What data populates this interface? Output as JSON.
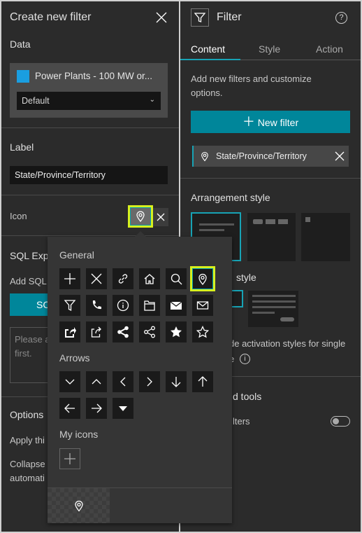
{
  "left": {
    "title": "Create new filter",
    "data_heading": "Data",
    "layer_name": "Power Plants - 100 MW or...",
    "view_select": "Default",
    "label_heading": "Label",
    "label_value": "State/Province/Territory",
    "icon_label": "Icon",
    "sql_heading": "SQL Exp",
    "sql_text": "Add SQL",
    "sql_button": "SC",
    "sql_placeholder_1": "Please a",
    "sql_placeholder_2": "first.",
    "options_heading": "Options",
    "apply_text": "Apply thi",
    "collapse_text_1": "Collapse",
    "collapse_text_2": "automati"
  },
  "right": {
    "title": "Filter",
    "tabs": [
      {
        "label": "Content",
        "active": true
      },
      {
        "label": "Style",
        "active": false
      },
      {
        "label": "Action",
        "active": false
      }
    ],
    "description": "Add new filters and customize options.",
    "new_filter_button": "New filter",
    "filter_item": "State/Province/Territory",
    "arrangement_heading": "Arrangement style",
    "activation_heading_fragment": "style",
    "activation_text_1": "de activation styles for single",
    "activation_text_2": "e",
    "tools_heading_fragment": "d tools",
    "filters_toggle_fragment": "lters",
    "toggle_on": false
  },
  "icon_picker": {
    "general_heading": "General",
    "general_icons": [
      "plus",
      "close",
      "link",
      "home",
      "search",
      "map-pin",
      "filter",
      "phone",
      "info",
      "folder",
      "envelope-filled",
      "envelope",
      "share-filled",
      "share",
      "share-nodes-filled",
      "share-nodes",
      "star-filled",
      "star"
    ],
    "selected_icon": "map-pin",
    "arrows_heading": "Arrows",
    "arrow_icons": [
      "chevron-down",
      "chevron-up",
      "chevron-left",
      "chevron-right",
      "arrow-down",
      "arrow-up",
      "arrow-left",
      "arrow-right",
      "caret-down"
    ],
    "my_icons_heading": "My icons",
    "preview_icon": "map-pin"
  },
  "colors": {
    "accent": "#00869a",
    "highlight": "#d7f01e",
    "panel": "#2b2b2b",
    "popup": "#353535"
  }
}
